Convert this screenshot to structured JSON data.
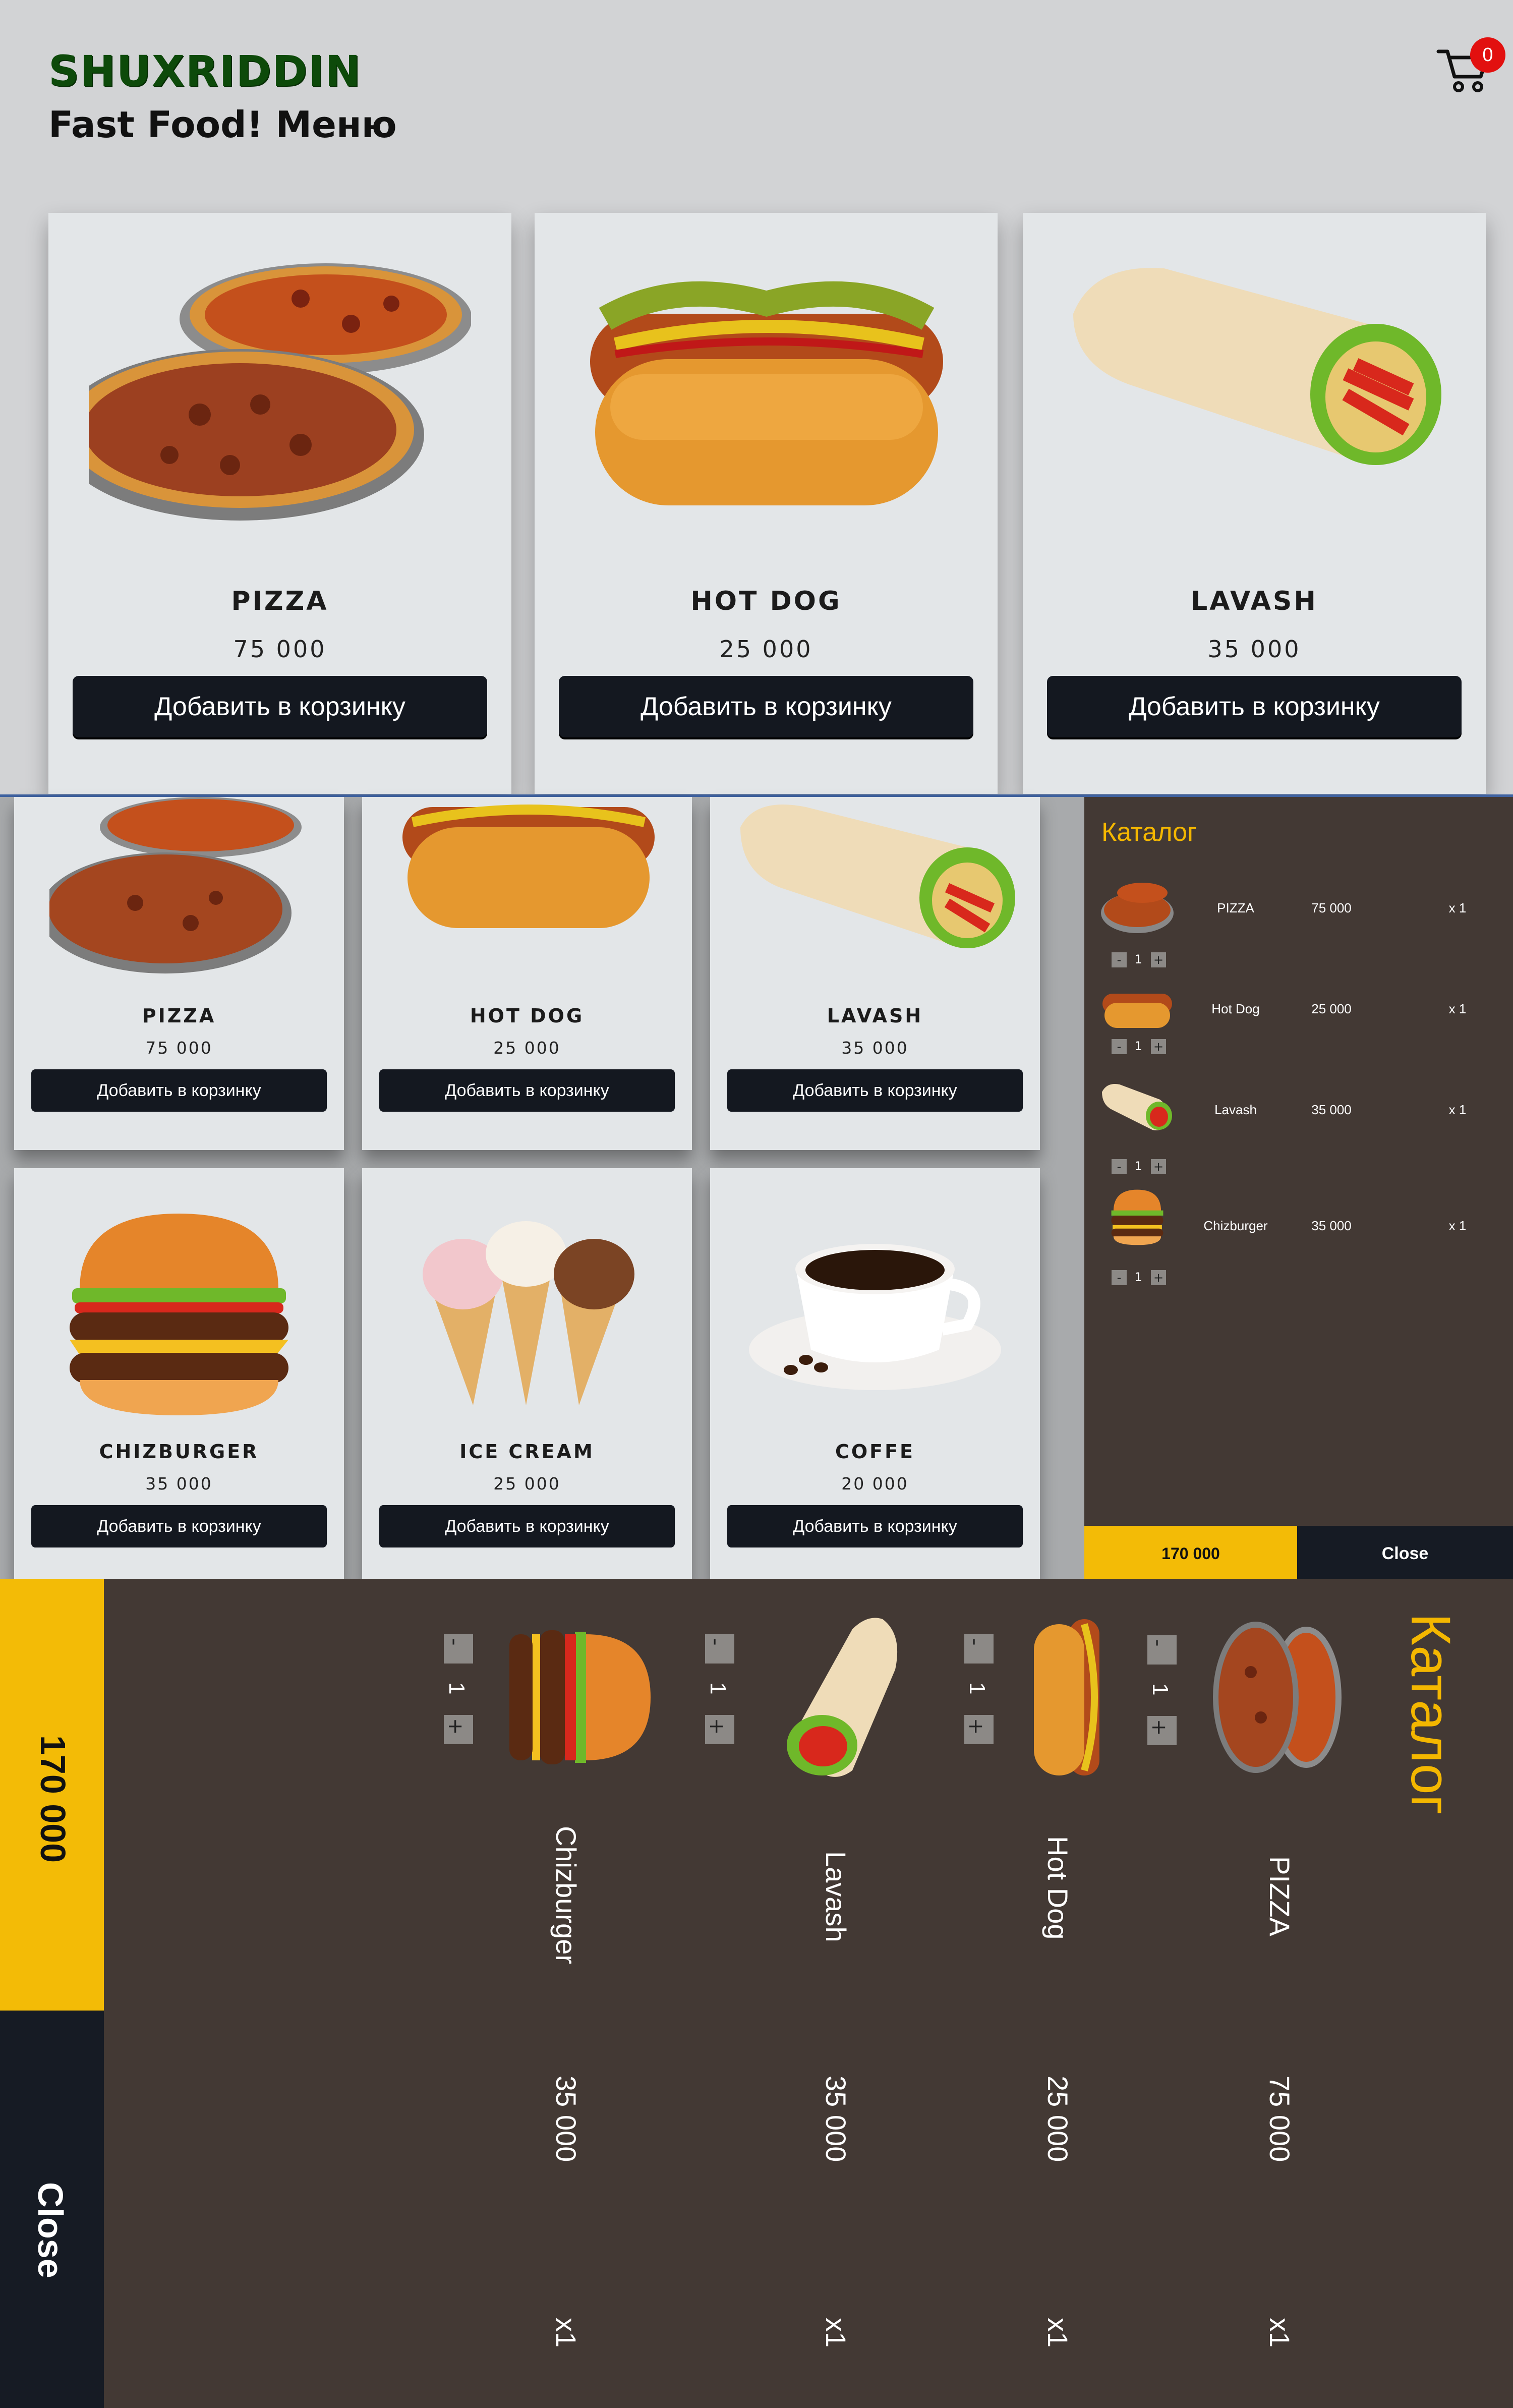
{
  "header": {
    "brand": "SHUXRIDDIN",
    "title": "Fast Food! Меню",
    "cart_count": "0"
  },
  "menu_top": [
    {
      "name": "PIZZA",
      "price": "75 000",
      "button": "Добавить в корзинку"
    },
    {
      "name": "HOT DOG",
      "price": "25 000",
      "button": "Добавить в корзинку"
    },
    {
      "name": "LAVASH",
      "price": "35 000",
      "button": "Добавить в корзинку"
    }
  ],
  "menu_grid": [
    {
      "name": "PIZZA",
      "price": "75 000",
      "button": "Добавить в корзинку"
    },
    {
      "name": "HOT DOG",
      "price": "25 000",
      "button": "Добавить в корзинку"
    },
    {
      "name": "LAVASH",
      "price": "35 000",
      "button": "Добавить в корзинку"
    },
    {
      "name": "CHIZBURGER",
      "price": "35 000",
      "button": "Добавить в корзинку"
    },
    {
      "name": "ICE CREAM",
      "price": "25 000",
      "button": "Добавить в корзинку"
    },
    {
      "name": "COFFE",
      "price": "20 000",
      "button": "Добавить в корзинку"
    }
  ],
  "cart_panel": {
    "title": "Каталог",
    "items": [
      {
        "name": "PIZZA",
        "price": "75 000",
        "qty_label": "x 1",
        "qty": "1",
        "minus": "-",
        "plus": "+"
      },
      {
        "name": "Hot Dog",
        "price": "25 000",
        "qty_label": "x 1",
        "qty": "1",
        "minus": "-",
        "plus": "+"
      },
      {
        "name": "Lavash",
        "price": "35 000",
        "qty_label": "x 1",
        "qty": "1",
        "minus": "-",
        "plus": "+"
      },
      {
        "name": "Chizburger",
        "price": "35 000",
        "qty_label": "x 1",
        "qty": "1",
        "minus": "-",
        "plus": "+"
      }
    ],
    "total": "170 000",
    "close": "Close"
  },
  "rotated_panel": {
    "title": "Каталог",
    "items": [
      {
        "name": "Chizburger",
        "price": "35 000",
        "qty_label": "x1",
        "qty": "1",
        "minus": "-",
        "plus": "+"
      },
      {
        "name": "Lavash",
        "price": "35 000",
        "qty_label": "x1",
        "qty": "1",
        "minus": "-",
        "plus": "+"
      },
      {
        "name": "Hot Dog",
        "price": "25 000",
        "qty_label": "x1",
        "qty": "1",
        "minus": "-",
        "plus": "+"
      },
      {
        "name": "PIZZA",
        "price": "75 000",
        "qty_label": "x1",
        "qty": "1",
        "minus": "-",
        "plus": "+"
      }
    ],
    "total": "170 000",
    "close": "Close"
  },
  "colors": {
    "accent": "#f3bb06",
    "dark": "#161b24",
    "panel": "#433934",
    "brand": "#0d4a0a",
    "badge": "#e2100f"
  }
}
